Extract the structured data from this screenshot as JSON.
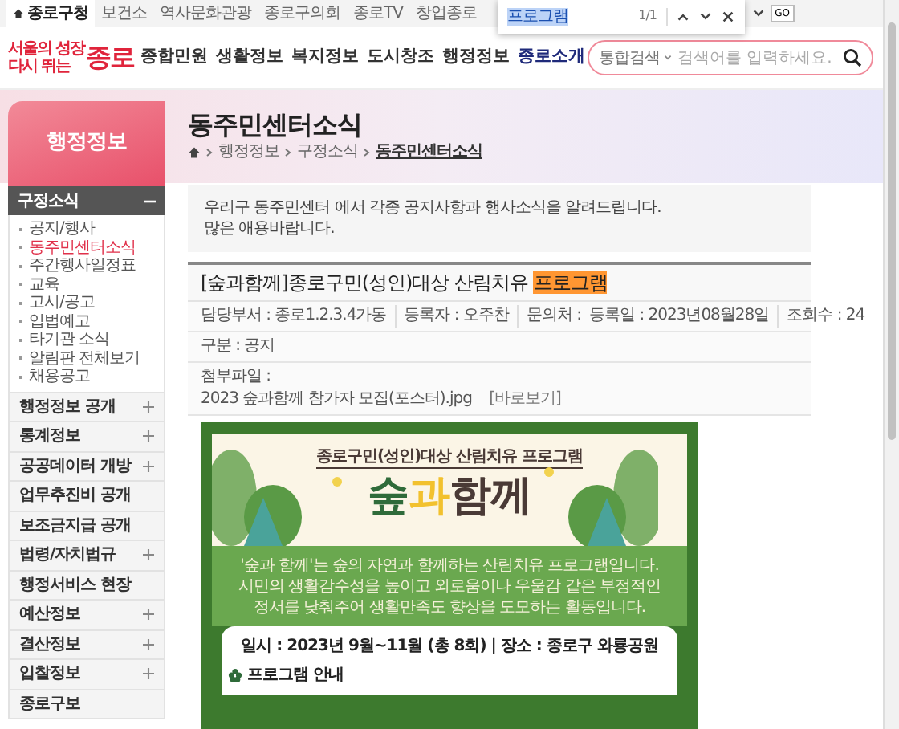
{
  "util_bar": {
    "items": [
      {
        "label": "종로구청",
        "selected": true
      },
      {
        "label": "보건소",
        "selected": false
      },
      {
        "label": "역사문화관광",
        "selected": false
      },
      {
        "label": "종로구의회",
        "selected": false
      },
      {
        "label": "종로TV",
        "selected": false
      },
      {
        "label": "창업종로",
        "selected": false
      }
    ],
    "go_button": "GO"
  },
  "find_bar": {
    "query": "프로그램",
    "count": "1/1"
  },
  "header": {
    "logo": {
      "tagline_lines": [
        "서울의 성장",
        "다시 뛰는"
      ],
      "name": "종로"
    },
    "nav": [
      {
        "label": "종합민원",
        "selected": false
      },
      {
        "label": "생활정보",
        "selected": false
      },
      {
        "label": "복지정보",
        "selected": false
      },
      {
        "label": "도시창조",
        "selected": false
      },
      {
        "label": "행정정보",
        "selected": false
      },
      {
        "label": "종로소개",
        "selected": true
      }
    ],
    "search": {
      "scope": "통합검색",
      "placeholder": "검색어를 입력하세요."
    }
  },
  "sidebar": {
    "title": "행정정보",
    "groups": [
      {
        "label": "구정소식",
        "expandable": true,
        "expanded": true,
        "children": [
          {
            "label": "공지/행사",
            "selected": false
          },
          {
            "label": "동주민센터소식",
            "selected": true
          },
          {
            "label": "주간행사일정표",
            "selected": false
          },
          {
            "label": "교육",
            "selected": false
          },
          {
            "label": "고시/공고",
            "selected": false
          },
          {
            "label": "입법예고",
            "selected": false
          },
          {
            "label": "타기관 소식",
            "selected": false
          },
          {
            "label": "알림판 전체보기",
            "selected": false
          },
          {
            "label": "채용공고",
            "selected": false
          }
        ]
      },
      {
        "label": "행정정보 공개",
        "expandable": true,
        "expanded": false
      },
      {
        "label": "통계정보",
        "expandable": true,
        "expanded": false
      },
      {
        "label": "공공데이터 개방",
        "expandable": true,
        "expanded": false
      },
      {
        "label": "업무추진비 공개",
        "expandable": false,
        "expanded": false
      },
      {
        "label": "보조금지급 공개",
        "expandable": false,
        "expanded": false
      },
      {
        "label": "법령/자치법규",
        "expandable": true,
        "expanded": false
      },
      {
        "label": "행정서비스 현장",
        "expandable": false,
        "expanded": false
      },
      {
        "label": "예산정보",
        "expandable": true,
        "expanded": false
      },
      {
        "label": "결산정보",
        "expandable": true,
        "expanded": false
      },
      {
        "label": "입찰정보",
        "expandable": true,
        "expanded": false
      },
      {
        "label": "종로구보",
        "expandable": false,
        "expanded": false
      }
    ]
  },
  "page": {
    "title": "동주민센터소식",
    "breadcrumb": [
      "행정정보",
      "구정소식",
      "동주민센터소식"
    ],
    "intro_lines": [
      "우리구 동주민센터 에서 각종 공지사항과 행사소식을 알려드립니다.",
      "많은 애용바랍니다."
    ],
    "post": {
      "title": "[숲과함께]종로구민(성인)대상 산림치유 ",
      "title_match": "프로그램",
      "meta_left": [
        "담당부서 : 종로1.2.3.4가동",
        "등록자 : 오주찬",
        "문의처 :"
      ],
      "meta_right": [
        "등록일 : 2023년08월28일",
        "조회수 : 24"
      ],
      "category": "구분 : 공지",
      "attachment_label": "첨부파일 :",
      "attachment_file": "2023 숲과함께 참가자 모집(포스터).jpg",
      "attachment_view": "[바로보기]"
    },
    "poster": {
      "heading": "종로구민(성인)대상 산림치유 프로그램",
      "title_parts": [
        {
          "text": "숲",
          "color": "#2f6b3a"
        },
        {
          "text": "과",
          "color": "#f2c12e"
        },
        {
          "text": "함께",
          "color": "#4a3a36"
        }
      ],
      "description_lines": [
        "'숲과 함께'는 숲의 자연과 함께하는 산림치유 프로그램입니다.",
        "시민의 생활감수성을 높이고 외로움이나 우울감 같은 부정적인",
        "정서를 낮춰주어 생활만족도 향상을 도모하는 활동입니다."
      ],
      "details": "일시 : 2023년 9월~11월 (총 8회)  |  장소 : 종로구 와룡공원",
      "section": "프로그램 안내"
    }
  }
}
